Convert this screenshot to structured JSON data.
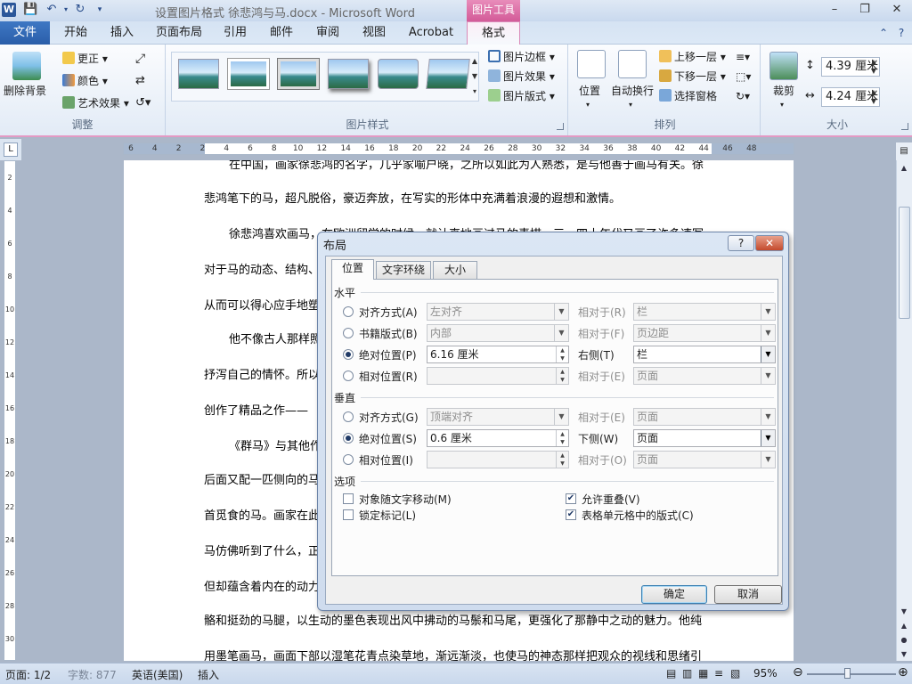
{
  "window": {
    "title": "设置图片格式 徐悲鸿与马.docx - Microsoft Word",
    "context_tab_group": "图片工具",
    "app_icon": "W"
  },
  "tabs": [
    "文件",
    "开始",
    "插入",
    "页面布局",
    "引用",
    "邮件",
    "审阅",
    "视图",
    "Acrobat",
    "格式"
  ],
  "ribbon": {
    "adjust": {
      "remove_bg": "删除背景",
      "corrections": "更正",
      "color": "颜色",
      "artistic": "艺术效果",
      "label": "调整"
    },
    "styles": {
      "border": "图片边框",
      "effects": "图片效果",
      "layout": "图片版式",
      "label": "图片样式"
    },
    "arrange": {
      "position": "位置",
      "wrap": "自动换行",
      "bring_forward": "上移一层",
      "send_backward": "下移一层",
      "selection_pane": "选择窗格",
      "label": "排列"
    },
    "size": {
      "crop": "裁剪",
      "height": "4.39 厘米",
      "width": "4.24 厘米",
      "label": "大小"
    }
  },
  "ruler": {
    "ticks": [
      "6",
      "4",
      "2",
      "2",
      "4",
      "6",
      "8",
      "10",
      "12",
      "14",
      "16",
      "18",
      "20",
      "22",
      "24",
      "26",
      "28",
      "30",
      "32",
      "34",
      "36",
      "38",
      "40",
      "42",
      "44",
      "46",
      "48"
    ],
    "vticks": [
      "2",
      "4",
      "6",
      "8",
      "10",
      "12",
      "14",
      "16",
      "18",
      "20",
      "22",
      "24",
      "26",
      "28",
      "30"
    ]
  },
  "document": {
    "lines": [
      "在中国，画家徐悲鸿的名字，几乎家喻户晓，之所以如此为人熟悉，是与他善于画马有关。徐",
      "悲鸿笔下的马，超凡脱俗，豪迈奔放，在写实的形体中充满着浪漫的遐想和激情。",
      "徐悲鸿喜欢画马，在欧洲留学的时候，就认真地画过马的素描，三、四十年代又画了许多速写",
      "对于马的动态、结构、",
      "从而可以得心应手地塑",
      "他不像古人那样照",
      "抒泻自己的情怀。所以",
      "创作了精品之作——",
      "《群马》与其他作",
      "后面又配一匹侧向的马",
      "首觅食的马。画家在此",
      "马仿佛听到了什么，正",
      "但却蕴含着内在的动力",
      "骼和挺劲的马腿，以生动的墨色表现出风中拂动的马鬃和马尾，更强化了那静中之动的魅力。他纯",
      "用墨笔画马，画面下部以湿笔花青点染草地，渐远渐淡，也使马的神态那样把观众的视线和思绪引"
    ]
  },
  "dialog": {
    "title": "布局",
    "help": "?",
    "close": "✕",
    "tabs": [
      "位置",
      "文字环绕",
      "大小"
    ],
    "horizontal": {
      "heading": "水平",
      "align_label": "对齐方式(A)",
      "align_value": "左对齐",
      "align_rel_label": "相对于(R)",
      "align_rel_value": "栏",
      "book_label": "书籍版式(B)",
      "book_value": "内部",
      "book_rel_label": "相对于(F)",
      "book_rel_value": "页边距",
      "abs_label": "绝对位置(P)",
      "abs_value": "6.16 厘米",
      "abs_rel_label": "右侧(T)",
      "abs_rel_value": "栏",
      "rel_label": "相对位置(R)",
      "rel_value": "",
      "rel_rel_label": "相对于(E)",
      "rel_rel_value": "页面"
    },
    "vertical": {
      "heading": "垂直",
      "align_label": "对齐方式(G)",
      "align_value": "顶端对齐",
      "align_rel_label": "相对于(E)",
      "align_rel_value": "页面",
      "abs_label": "绝对位置(S)",
      "abs_value": "0.6 厘米",
      "abs_rel_label": "下侧(W)",
      "abs_rel_value": "页面",
      "rel_label": "相对位置(I)",
      "rel_value": "",
      "rel_rel_label": "相对于(O)",
      "rel_rel_value": "页面"
    },
    "options": {
      "heading": "选项",
      "move_with_text": "对象随文字移动(M)",
      "lock_anchor": "锁定标记(L)",
      "allow_overlap": "允许重叠(V)",
      "layout_in_cell": "表格单元格中的版式(C)"
    },
    "ok": "确定",
    "cancel": "取消"
  },
  "status": {
    "page": "页面: 1/2",
    "words": "字数: 877",
    "language": "英语(美国)",
    "mode": "插入",
    "zoom": "95%"
  },
  "colors": {
    "file_tab": "#2a5ea9",
    "context_tab": "#d35b98",
    "dialog_border": "#6c84a8"
  }
}
